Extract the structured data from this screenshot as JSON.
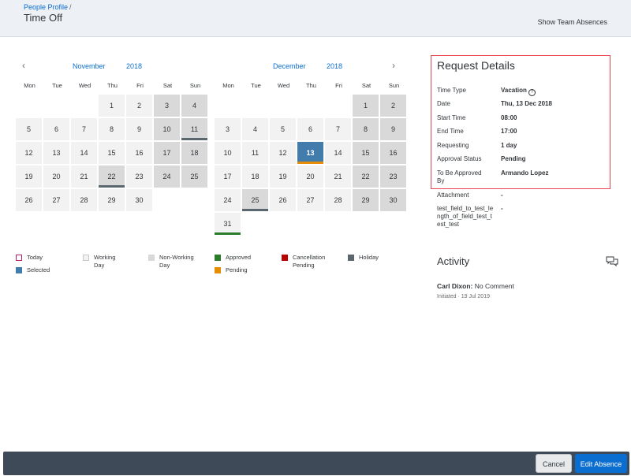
{
  "header": {
    "breadcrumb": "People Profile",
    "breadcrumb_sep": "/",
    "title": "Time Off",
    "show_team_absences": "Show Team Absences"
  },
  "calendars": [
    {
      "month": "November",
      "year": "2018",
      "nav": "prev",
      "nav_glyph": "‹",
      "weekdays": [
        "Mon",
        "Tue",
        "Wed",
        "Thu",
        "Fri",
        "Sat",
        "Sun"
      ],
      "days": [
        {
          "d": "1",
          "col": 3,
          "row": 0,
          "type": "w"
        },
        {
          "d": "2",
          "col": 4,
          "row": 0,
          "type": "w"
        },
        {
          "d": "3",
          "col": 5,
          "row": 0,
          "type": "nw"
        },
        {
          "d": "4",
          "col": 6,
          "row": 0,
          "type": "nw"
        },
        {
          "d": "5",
          "col": 0,
          "row": 1,
          "type": "w"
        },
        {
          "d": "6",
          "col": 1,
          "row": 1,
          "type": "w"
        },
        {
          "d": "7",
          "col": 2,
          "row": 1,
          "type": "w"
        },
        {
          "d": "8",
          "col": 3,
          "row": 1,
          "type": "w"
        },
        {
          "d": "9",
          "col": 4,
          "row": 1,
          "type": "w"
        },
        {
          "d": "10",
          "col": 5,
          "row": 1,
          "type": "nw"
        },
        {
          "d": "11",
          "col": 6,
          "row": 1,
          "type": "nw",
          "bar": "holiday"
        },
        {
          "d": "12",
          "col": 0,
          "row": 2,
          "type": "w"
        },
        {
          "d": "13",
          "col": 1,
          "row": 2,
          "type": "w"
        },
        {
          "d": "14",
          "col": 2,
          "row": 2,
          "type": "w"
        },
        {
          "d": "15",
          "col": 3,
          "row": 2,
          "type": "w"
        },
        {
          "d": "16",
          "col": 4,
          "row": 2,
          "type": "w"
        },
        {
          "d": "17",
          "col": 5,
          "row": 2,
          "type": "nw"
        },
        {
          "d": "18",
          "col": 6,
          "row": 2,
          "type": "nw"
        },
        {
          "d": "19",
          "col": 0,
          "row": 3,
          "type": "w"
        },
        {
          "d": "20",
          "col": 1,
          "row": 3,
          "type": "w"
        },
        {
          "d": "21",
          "col": 2,
          "row": 3,
          "type": "w"
        },
        {
          "d": "22",
          "col": 3,
          "row": 3,
          "type": "nw",
          "bar": "holiday"
        },
        {
          "d": "23",
          "col": 4,
          "row": 3,
          "type": "w"
        },
        {
          "d": "24",
          "col": 5,
          "row": 3,
          "type": "nw"
        },
        {
          "d": "25",
          "col": 6,
          "row": 3,
          "type": "nw"
        },
        {
          "d": "26",
          "col": 0,
          "row": 4,
          "type": "w"
        },
        {
          "d": "27",
          "col": 1,
          "row": 4,
          "type": "w"
        },
        {
          "d": "28",
          "col": 2,
          "row": 4,
          "type": "w"
        },
        {
          "d": "29",
          "col": 3,
          "row": 4,
          "type": "w"
        },
        {
          "d": "30",
          "col": 4,
          "row": 4,
          "type": "w"
        }
      ]
    },
    {
      "month": "December",
      "year": "2018",
      "nav": "next",
      "nav_glyph": "›",
      "weekdays": [
        "Mon",
        "Tue",
        "Wed",
        "Thu",
        "Fri",
        "Sat",
        "Sun"
      ],
      "days": [
        {
          "d": "1",
          "col": 5,
          "row": 0,
          "type": "nw"
        },
        {
          "d": "2",
          "col": 6,
          "row": 0,
          "type": "nw"
        },
        {
          "d": "3",
          "col": 0,
          "row": 1,
          "type": "w"
        },
        {
          "d": "4",
          "col": 1,
          "row": 1,
          "type": "w"
        },
        {
          "d": "5",
          "col": 2,
          "row": 1,
          "type": "w"
        },
        {
          "d": "6",
          "col": 3,
          "row": 1,
          "type": "w"
        },
        {
          "d": "7",
          "col": 4,
          "row": 1,
          "type": "w"
        },
        {
          "d": "8",
          "col": 5,
          "row": 1,
          "type": "nw"
        },
        {
          "d": "9",
          "col": 6,
          "row": 1,
          "type": "nw"
        },
        {
          "d": "10",
          "col": 0,
          "row": 2,
          "type": "w"
        },
        {
          "d": "11",
          "col": 1,
          "row": 2,
          "type": "w"
        },
        {
          "d": "12",
          "col": 2,
          "row": 2,
          "type": "w"
        },
        {
          "d": "13",
          "col": 3,
          "row": 2,
          "type": "sel",
          "bar": "pending"
        },
        {
          "d": "14",
          "col": 4,
          "row": 2,
          "type": "w"
        },
        {
          "d": "15",
          "col": 5,
          "row": 2,
          "type": "nw"
        },
        {
          "d": "16",
          "col": 6,
          "row": 2,
          "type": "nw"
        },
        {
          "d": "17",
          "col": 0,
          "row": 3,
          "type": "w"
        },
        {
          "d": "18",
          "col": 1,
          "row": 3,
          "type": "w"
        },
        {
          "d": "19",
          "col": 2,
          "row": 3,
          "type": "w"
        },
        {
          "d": "20",
          "col": 3,
          "row": 3,
          "type": "w"
        },
        {
          "d": "21",
          "col": 4,
          "row": 3,
          "type": "w"
        },
        {
          "d": "22",
          "col": 5,
          "row": 3,
          "type": "nw"
        },
        {
          "d": "23",
          "col": 6,
          "row": 3,
          "type": "nw"
        },
        {
          "d": "24",
          "col": 0,
          "row": 4,
          "type": "w"
        },
        {
          "d": "25",
          "col": 1,
          "row": 4,
          "type": "nw",
          "bar": "holiday"
        },
        {
          "d": "26",
          "col": 2,
          "row": 4,
          "type": "w"
        },
        {
          "d": "27",
          "col": 3,
          "row": 4,
          "type": "w"
        },
        {
          "d": "28",
          "col": 4,
          "row": 4,
          "type": "w"
        },
        {
          "d": "29",
          "col": 5,
          "row": 4,
          "type": "nw"
        },
        {
          "d": "30",
          "col": 6,
          "row": 4,
          "type": "nw"
        },
        {
          "d": "31",
          "col": 0,
          "row": 5,
          "type": "w",
          "bar": "approved"
        }
      ]
    }
  ],
  "legend": [
    {
      "key": "today",
      "label": "Today",
      "color": "#b0226b",
      "style": "outline"
    },
    {
      "key": "working-day",
      "label": "Working Day",
      "color": "#f2f2f2",
      "style": "outline"
    },
    {
      "key": "non-working-day",
      "label": "Non-Working Day",
      "color": "#d9d9d9",
      "style": "fill"
    },
    {
      "key": "approved",
      "label": "Approved",
      "color": "#2b7d2b",
      "style": "fill"
    },
    {
      "key": "cancellation-pending",
      "label": "Cancellation Pending",
      "color": "#bb0000",
      "style": "fill"
    },
    {
      "key": "holiday",
      "label": "Holiday",
      "color": "#5b676f",
      "style": "fill"
    },
    {
      "key": "selected",
      "label": "Selected",
      "color": "#427cac",
      "style": "fill"
    },
    {
      "key": "pending",
      "label": "Pending",
      "color": "#e78c07",
      "style": "fill"
    }
  ],
  "request_details": {
    "title": "Request Details",
    "fields": [
      {
        "label": "Time Type",
        "value": "Vacation",
        "help": true
      },
      {
        "label": "Date",
        "value": "Thu, 13 Dec 2018"
      },
      {
        "label": "Start Time",
        "value": "08:00"
      },
      {
        "label": "End Time",
        "value": "17:00"
      },
      {
        "label": "Requesting",
        "value": "1 day"
      },
      {
        "label": "Approval Status",
        "value": "Pending"
      },
      {
        "label": "To Be Approved By",
        "value": "Armando Lopez"
      },
      {
        "label": "Attachment",
        "value": "-"
      },
      {
        "label": "test_field_to_test_length_of_field_test_test_test",
        "value": "-"
      }
    ],
    "help_glyph": "?"
  },
  "activity": {
    "title": "Activity",
    "entries": [
      {
        "name": "Carl Dixon:",
        "comment": "No Comment",
        "status": "Initiated",
        "dot": "·",
        "date": "19 Jul 2019"
      }
    ]
  },
  "footer": {
    "cancel": "Cancel",
    "edit": "Edit Absence"
  },
  "colors": {
    "accent": "#0a6ed1",
    "selected": "#427cac",
    "highlight_box": "#e8434f",
    "footer_bg": "#3e4a58"
  }
}
